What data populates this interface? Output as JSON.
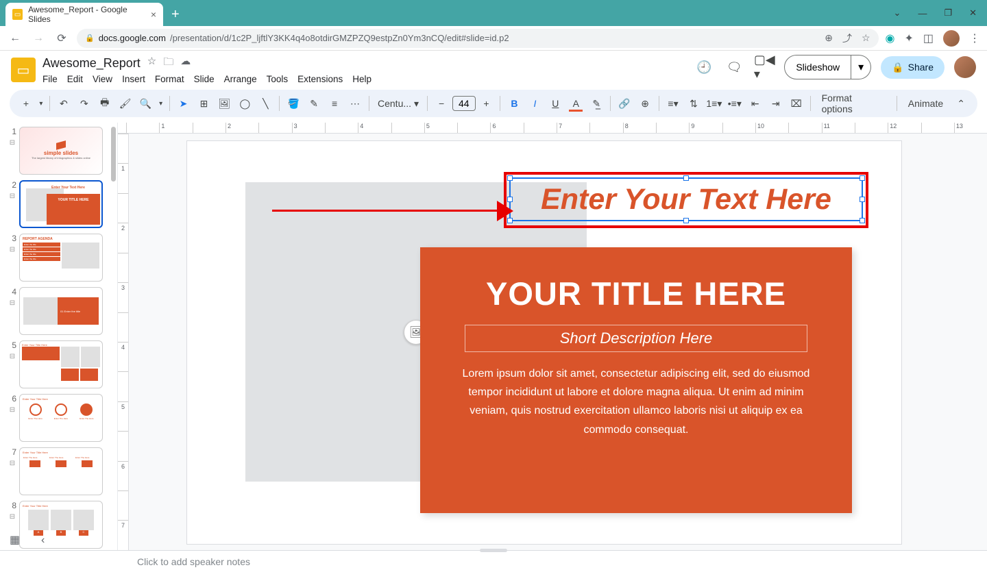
{
  "browser": {
    "tab_title": "Awesome_Report - Google Slides",
    "url_domain": "docs.google.com",
    "url_path": "/presentation/d/1c2P_ljftlY3KK4q4o8otdirGMZPZQ9estpZn0Ym3nCQ/edit#slide=id.p2"
  },
  "doc": {
    "title": "Awesome_Report"
  },
  "menus": [
    "File",
    "Edit",
    "View",
    "Insert",
    "Format",
    "Slide",
    "Arrange",
    "Tools",
    "Extensions",
    "Help"
  ],
  "header": {
    "slideshow": "Slideshow",
    "share": "Share"
  },
  "toolbar": {
    "font_name": "Centu...",
    "font_size": "44",
    "format_options": "Format options",
    "animate": "Animate"
  },
  "slide": {
    "textbox": "Enter Your Text Here",
    "title": "YOUR TITLE HERE",
    "subtitle": "Short Description Here",
    "body": "Lorem ipsum dolor sit amet, consectetur adipiscing elit, sed do eiusmod tempor incididunt ut labore et dolore magna aliqua. Ut enim ad minim veniam, quis nostrud exercitation ullamco laboris nisi ut aliquip ex ea commodo consequat."
  },
  "ruler_h": [
    "",
    "1",
    "",
    "2",
    "",
    "3",
    "",
    "4",
    "",
    "5",
    "",
    "6",
    "",
    "7",
    "",
    "8",
    "",
    "9",
    "",
    "10",
    "",
    "11",
    "",
    "12",
    "",
    "13"
  ],
  "ruler_v": [
    "",
    "1",
    "",
    "2",
    "",
    "3",
    "",
    "4",
    "",
    "5",
    "",
    "6",
    "",
    "7"
  ],
  "thumbnails": {
    "t1_logo": "simple slides",
    "t1_sub": "The largest library of infographics & slides online",
    "t2_top": "Enter Your Text Here",
    "t2_title": "YOUR TITLE HERE",
    "t3_title": "REPORT AGENDA",
    "t3_item": "Enter the title",
    "t4_text": "01 Enter the title",
    "t5_top": "Enter Your Title Here",
    "t6_top": "Enter Your Title Here",
    "t6_lbl": "Enter The Here",
    "t7_top": "Enter Your Title Here",
    "t7_a": "Enter The Here",
    "t8_top": "Enter Your Title Here",
    "t8_a": "A",
    "t8_b": "B",
    "t8_c": "C"
  },
  "speaker_notes_placeholder": "Click to add speaker notes",
  "colors": {
    "accent": "#d9542a",
    "selection": "#1a73e8",
    "highlight": "#e60000"
  }
}
